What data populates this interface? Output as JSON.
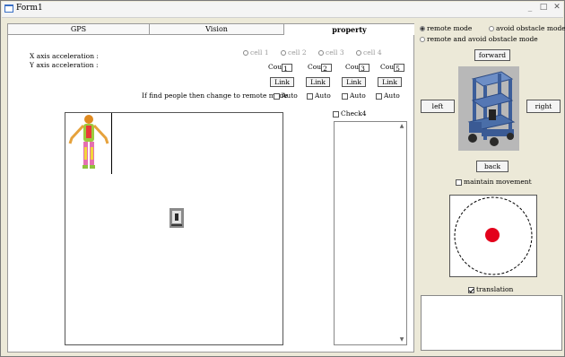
{
  "window": {
    "title": "Form1",
    "controls": [
      "_",
      "□",
      "✕"
    ]
  },
  "tabs": [
    "GPS",
    "Vision",
    "property"
  ],
  "accel": {
    "x_label": "X axis acceleration :",
    "y_label": "Y axis acceleration :"
  },
  "cells": [
    {
      "radio": "cell 1",
      "count_label": "Cou",
      "count_value": "1",
      "link": "Link",
      "auto": "Auto"
    },
    {
      "radio": "cell 2",
      "count_label": "Cou",
      "count_value": "2",
      "link": "Link",
      "auto": "Auto"
    },
    {
      "radio": "cell 3",
      "count_label": "Cou",
      "count_value": "3",
      "link": "Link",
      "auto": "Auto"
    },
    {
      "radio": "cell 4",
      "count_label": "Cou",
      "count_value": "5",
      "link": "Link",
      "auto": "Auto"
    }
  ],
  "remote_prompt": "If find people then change to remote mode",
  "check4": "Check4",
  "modes": {
    "remote": "remote mode",
    "avoid": "avoid obstacle mode",
    "remote_avoid": "remote and avoid obstacle mode"
  },
  "nav": {
    "forward": "forward",
    "left": "left",
    "right": "right",
    "back": "back"
  },
  "maintain": "maintain movement",
  "translation": "translation",
  "colors": {
    "panel": "#ece9d8",
    "joystick_dot": "#e3001b",
    "robot_bg": "#b8b8b8",
    "robot": "#4a6ea8"
  }
}
